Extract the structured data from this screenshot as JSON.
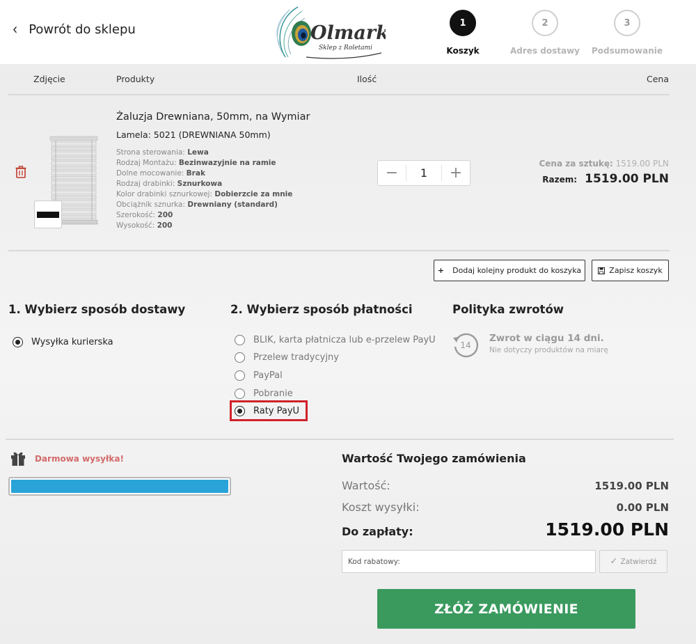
{
  "header": {
    "back_label": "Powrót do sklepu",
    "logo_text": "Olmark",
    "logo_sub": "Sklep z Roletami",
    "steps": [
      {
        "num": "1",
        "label": "Koszyk"
      },
      {
        "num": "2",
        "label": "Adres dostawy"
      },
      {
        "num": "3",
        "label": "Podsumowanie"
      }
    ]
  },
  "cart": {
    "columns": {
      "image": "Zdjęcie",
      "products": "Produkty",
      "qty": "Ilość",
      "price": "Cena"
    },
    "item": {
      "title": "Żaluzja Drewniana, 50mm, na Wymiar",
      "lamela": "Lamela: 5021 (DREWNIANA 50mm)",
      "attributes": [
        {
          "label": "Strona sterowania:",
          "value": "Lewa"
        },
        {
          "label": "Rodzaj Montażu:",
          "value": "Bezinwazyjnie na ramie"
        },
        {
          "label": "Dolne mocowanie:",
          "value": "Brak"
        },
        {
          "label": "Rodzaj drabinki:",
          "value": "Sznurkowa"
        },
        {
          "label": "Kolor drabinki sznurkowej:",
          "value": "Dobierzcie za mnie"
        },
        {
          "label": "Obciążnik sznurka:",
          "value": "Drewniany (standard)"
        },
        {
          "label": "Szerokość:",
          "value": "200"
        },
        {
          "label": "Wysokość:",
          "value": "200"
        }
      ],
      "qty_minus": "−",
      "quantity": "1",
      "qty_plus": "+",
      "unit_price_label": "Cena za sztukę:",
      "unit_price": "1519.00 PLN",
      "total_label": "Razem:",
      "total": "1519.00 PLN"
    },
    "add_product_label": "Dodaj kolejny produkt do koszyka",
    "add_product_icon": "+",
    "save_cart_label": "Zapisz koszyk"
  },
  "delivery": {
    "title": "1. Wybierz sposób dostawy",
    "options": [
      {
        "label": "Wysyłka kurierska",
        "selected": true
      }
    ]
  },
  "payment": {
    "title": "2. Wybierz sposób płatności",
    "options": [
      {
        "label": "BLIK, karta płatnicza lub e-przelew PayU",
        "selected": false
      },
      {
        "label": "Przelew tradycyjny",
        "selected": false
      },
      {
        "label": "PayPal",
        "selected": false
      },
      {
        "label": "Pobranie",
        "selected": false
      },
      {
        "label": "Raty PayU",
        "selected": true
      }
    ],
    "highlight_color": "#d0222a"
  },
  "returns": {
    "title": "Polityka zwrotów",
    "icon_number": "14",
    "headline": "Zwrot w ciągu 14 dni.",
    "note": "Nie dotyczy produktów na miarę"
  },
  "shipping_bar": {
    "label": "Darmowa wysyłka!",
    "progress_percent": 100,
    "color": "#2aa3d8"
  },
  "summary": {
    "title": "Wartość Twojego zamówienia",
    "value_label": "Wartość:",
    "value": "1519.00 PLN",
    "shipping_label": "Koszt wysyłki:",
    "shipping": "0.00 PLN",
    "pay_label": "Do zapłaty:",
    "pay": "1519.00 PLN",
    "coupon_placeholder": "Kod rabatowy:",
    "apply_label": "Zatwierdź",
    "order_label": "ZŁÓŻ ZAMÓWIENIE",
    "order_color": "#3a9a5e"
  }
}
